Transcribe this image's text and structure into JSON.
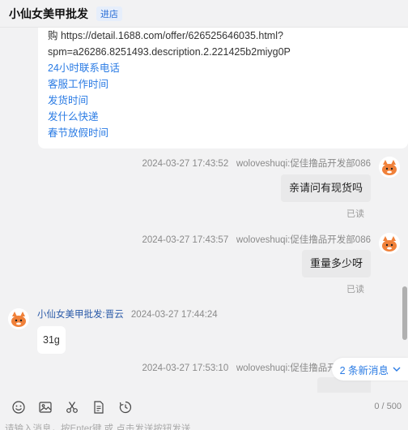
{
  "header": {
    "shop_name": "小仙女美甲批发",
    "shop_button": "进店"
  },
  "top_bubble": {
    "lines": [
      "购 https://detail.1688.com/offer/626525646035.html?",
      "spm=a26286.8251493.description.2.221425b2miyg0P"
    ],
    "links": [
      "24小时联系电话",
      "客服工作时间",
      "发货时间",
      "发什么快递",
      "春节放假时间"
    ]
  },
  "messages": [
    {
      "time": "2024-03-27 17:43:52",
      "sender": "woloveshuqi:促佳撸品开发部086",
      "text": "亲请问有现货吗",
      "status": "已读"
    },
    {
      "time": "2024-03-27 17:43:57",
      "sender": "woloveshuqi:促佳撸品开发部086",
      "text": "重量多少呀",
      "status": "已读"
    },
    {
      "time": "2024-03-27 17:44:24",
      "sender": "小仙女美甲批发:晋云",
      "text": "31g"
    },
    {
      "time": "2024-03-27 17:53:10",
      "sender": "woloveshuqi:促佳撸品开发部086",
      "text": ""
    }
  ],
  "new_messages": "2 条新消息",
  "input": {
    "counter": "0 / 500",
    "hint": "请输入消息，按Enter键 或 点击发送按钮发送"
  },
  "colors": {
    "link": "#2a7be4",
    "avatar_orange": "#f0813a"
  },
  "icons": [
    "emoji-icon",
    "image-icon",
    "scissors-icon",
    "file-icon",
    "history-icon",
    "chevron-down-icon"
  ]
}
